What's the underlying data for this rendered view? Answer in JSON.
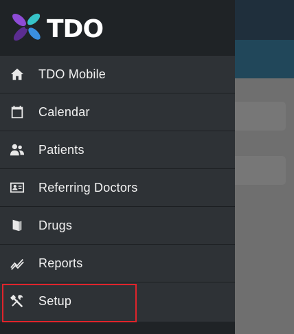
{
  "brand": {
    "name": "TDO",
    "colors": {
      "petal_purple": "#5b2d91",
      "petal_violet": "#8e4bd6",
      "petal_blue": "#3a8fe0",
      "petal_teal": "#37c3c8",
      "text": "#ffffff"
    }
  },
  "menu": {
    "items": [
      {
        "label": "TDO Mobile",
        "icon": "home-icon"
      },
      {
        "label": "Calendar",
        "icon": "calendar-icon"
      },
      {
        "label": "Patients",
        "icon": "patients-icon"
      },
      {
        "label": "Referring Doctors",
        "icon": "id-card-icon"
      },
      {
        "label": "Drugs",
        "icon": "drugs-icon"
      },
      {
        "label": "Reports",
        "icon": "reports-chart-icon"
      },
      {
        "label": "Setup",
        "icon": "tools-icon"
      }
    ],
    "highlighted": "Setup",
    "highlight_color": "#e0242b"
  }
}
